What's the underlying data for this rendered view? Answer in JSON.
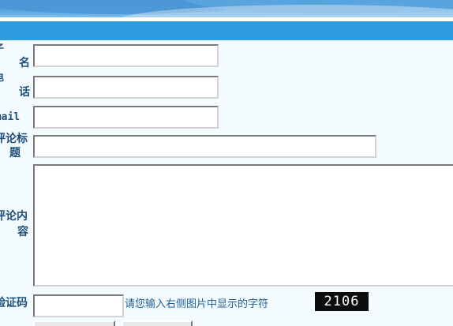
{
  "form": {
    "name_label_top": "子",
    "name_label": "名",
    "phone_label_top": "电",
    "phone_label": "话",
    "email_label": "Email",
    "title_label_line1": "评论标",
    "title_label_line2": "题",
    "content_label_line1": "评论内",
    "content_label_line2": "容",
    "captcha_label": "验证码",
    "name_value": "",
    "phone_value": "",
    "email_value": "",
    "title_value": "",
    "content_value": "",
    "captcha_value": "",
    "captcha_hint": "请您输入右侧图片中显示的字符",
    "captcha_code": "2106",
    "submit_label": "",
    "reset_label": ""
  },
  "colors": {
    "banner": "#3f8fd0",
    "bar": "#2f9be0",
    "background": "#f3fbfe",
    "label_text": "#1d4f7c"
  }
}
